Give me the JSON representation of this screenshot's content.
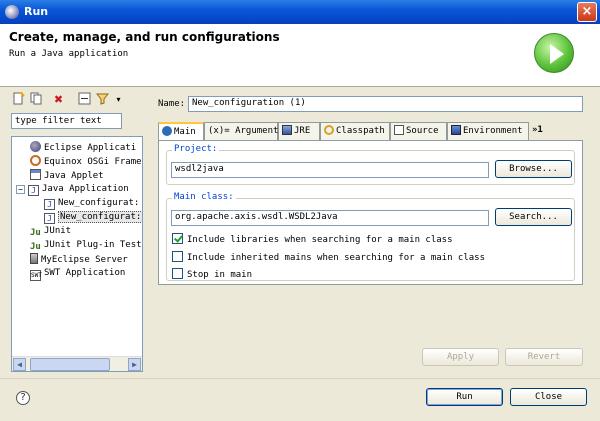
{
  "window": {
    "title": "Run",
    "close_label": "×"
  },
  "header": {
    "title": "Create, manage, and run configurations",
    "subtitle": "Run a Java application"
  },
  "left_panel": {
    "toolbar_icons": [
      "new-launch-config-icon",
      "duplicate-icon",
      "delete-icon",
      "collapse-all-icon",
      "filter-icon",
      "dropdown-arrow-icon"
    ],
    "filter_value": "type filter text",
    "tree": [
      {
        "label": "Eclipse Applicati",
        "icon": "eclipse-icon",
        "level": 0
      },
      {
        "label": "Equinox OSGi Frame",
        "icon": "osgi-icon",
        "level": 0
      },
      {
        "label": "Java Applet",
        "icon": "applet-icon",
        "level": 0
      },
      {
        "label": "Java Application",
        "icon": "java-app-icon",
        "level": 0,
        "expanded": true
      },
      {
        "label": "New_configurat:",
        "icon": "java-config-icon",
        "level": 1
      },
      {
        "label": "New_configurat:",
        "icon": "java-config-icon",
        "level": 1,
        "selected": true
      },
      {
        "label": "JUnit",
        "icon": "junit-icon",
        "level": 0
      },
      {
        "label": "JUnit Plug-in Test",
        "icon": "junit-plugin-icon",
        "level": 0
      },
      {
        "label": "MyEclipse Server",
        "icon": "server-icon",
        "level": 0
      },
      {
        "label": "SWT Application",
        "icon": "swt-icon",
        "level": 0
      }
    ]
  },
  "right_panel": {
    "name_label": "Name:",
    "name_value": "New_configuration (1)",
    "tabs": [
      {
        "label": "Main",
        "active": true
      },
      {
        "label": "(x)= Arguments"
      },
      {
        "label": "JRE"
      },
      {
        "label": "Classpath"
      },
      {
        "label": "Source"
      },
      {
        "label": "Environment"
      },
      {
        "label": "»1"
      }
    ],
    "project": {
      "label": "Project:",
      "value": "wsdl2java",
      "browse_label": "Browse..."
    },
    "main_class": {
      "label": "Main class:",
      "value": "org.apache.axis.wsdl.WSDL2Java",
      "search_label": "Search..."
    },
    "checkboxes": [
      {
        "label": "Include libraries when searching for a main class",
        "checked": true
      },
      {
        "label": "Include inherited mains when searching for a main class",
        "checked": false
      },
      {
        "label": "Stop in main",
        "checked": false
      }
    ],
    "apply_label": "Apply",
    "revert_label": "Revert"
  },
  "footer": {
    "help_label": "?",
    "run_label": "Run",
    "close_label": "Close"
  }
}
